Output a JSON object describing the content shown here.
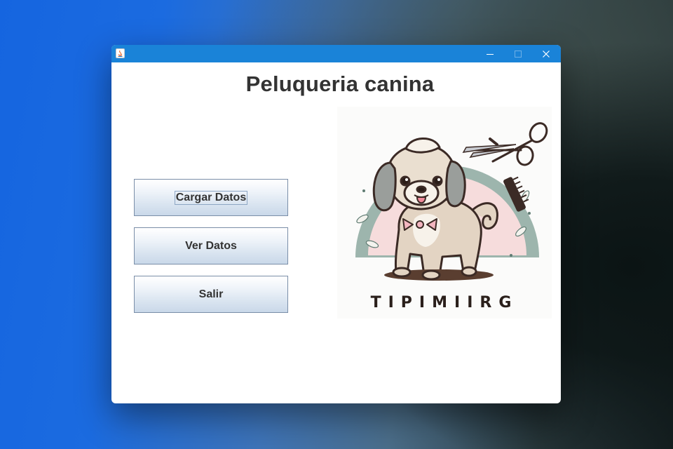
{
  "window": {
    "heading": "Peluqueria canina",
    "accent_color": "#1a83d8",
    "titlebar_controls": [
      "minimize-icon",
      "maximize-icon",
      "close-icon"
    ]
  },
  "menu": {
    "buttons": [
      {
        "label": "Cargar Datos",
        "focused": true
      },
      {
        "label": "Ver Datos",
        "focused": false
      },
      {
        "label": "Salir",
        "focused": false
      }
    ]
  },
  "logo": {
    "text": "TIPIMIIRG",
    "icons": [
      "dog-illustration",
      "scissors-icon",
      "comb-icon"
    ]
  }
}
